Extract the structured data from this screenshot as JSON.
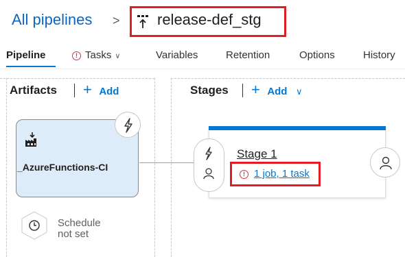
{
  "header": {
    "breadcrumb_root": "All pipelines",
    "separator": ">",
    "pipeline_name": "release-def_stg",
    "pipeline_icon": "release-pipeline-icon"
  },
  "tabs": [
    {
      "label": "Pipeline",
      "active": true
    },
    {
      "label": "Tasks",
      "has_warning": true,
      "has_dropdown": true
    },
    {
      "label": "Variables"
    },
    {
      "label": "Retention"
    },
    {
      "label": "Options"
    },
    {
      "label": "History"
    }
  ],
  "artifacts": {
    "title": "Artifacts",
    "add_label": "Add",
    "items": [
      {
        "name": "_AzureFunctions-CI",
        "icon": "build-artifact-icon",
        "trigger_icon": "lightning-icon"
      }
    ],
    "schedule": {
      "line1": "Schedule",
      "line2": "not set",
      "icon": "clock-icon"
    }
  },
  "stages": {
    "title": "Stages",
    "add_label": "Add",
    "items": [
      {
        "name": "Stage 1",
        "status_text": "1 job, 1 task",
        "status": "warning"
      }
    ]
  },
  "colors": {
    "accent": "#0078d4",
    "highlight": "#e31b23",
    "warning": "#d13438",
    "artifact_bg": "#deecf9"
  }
}
